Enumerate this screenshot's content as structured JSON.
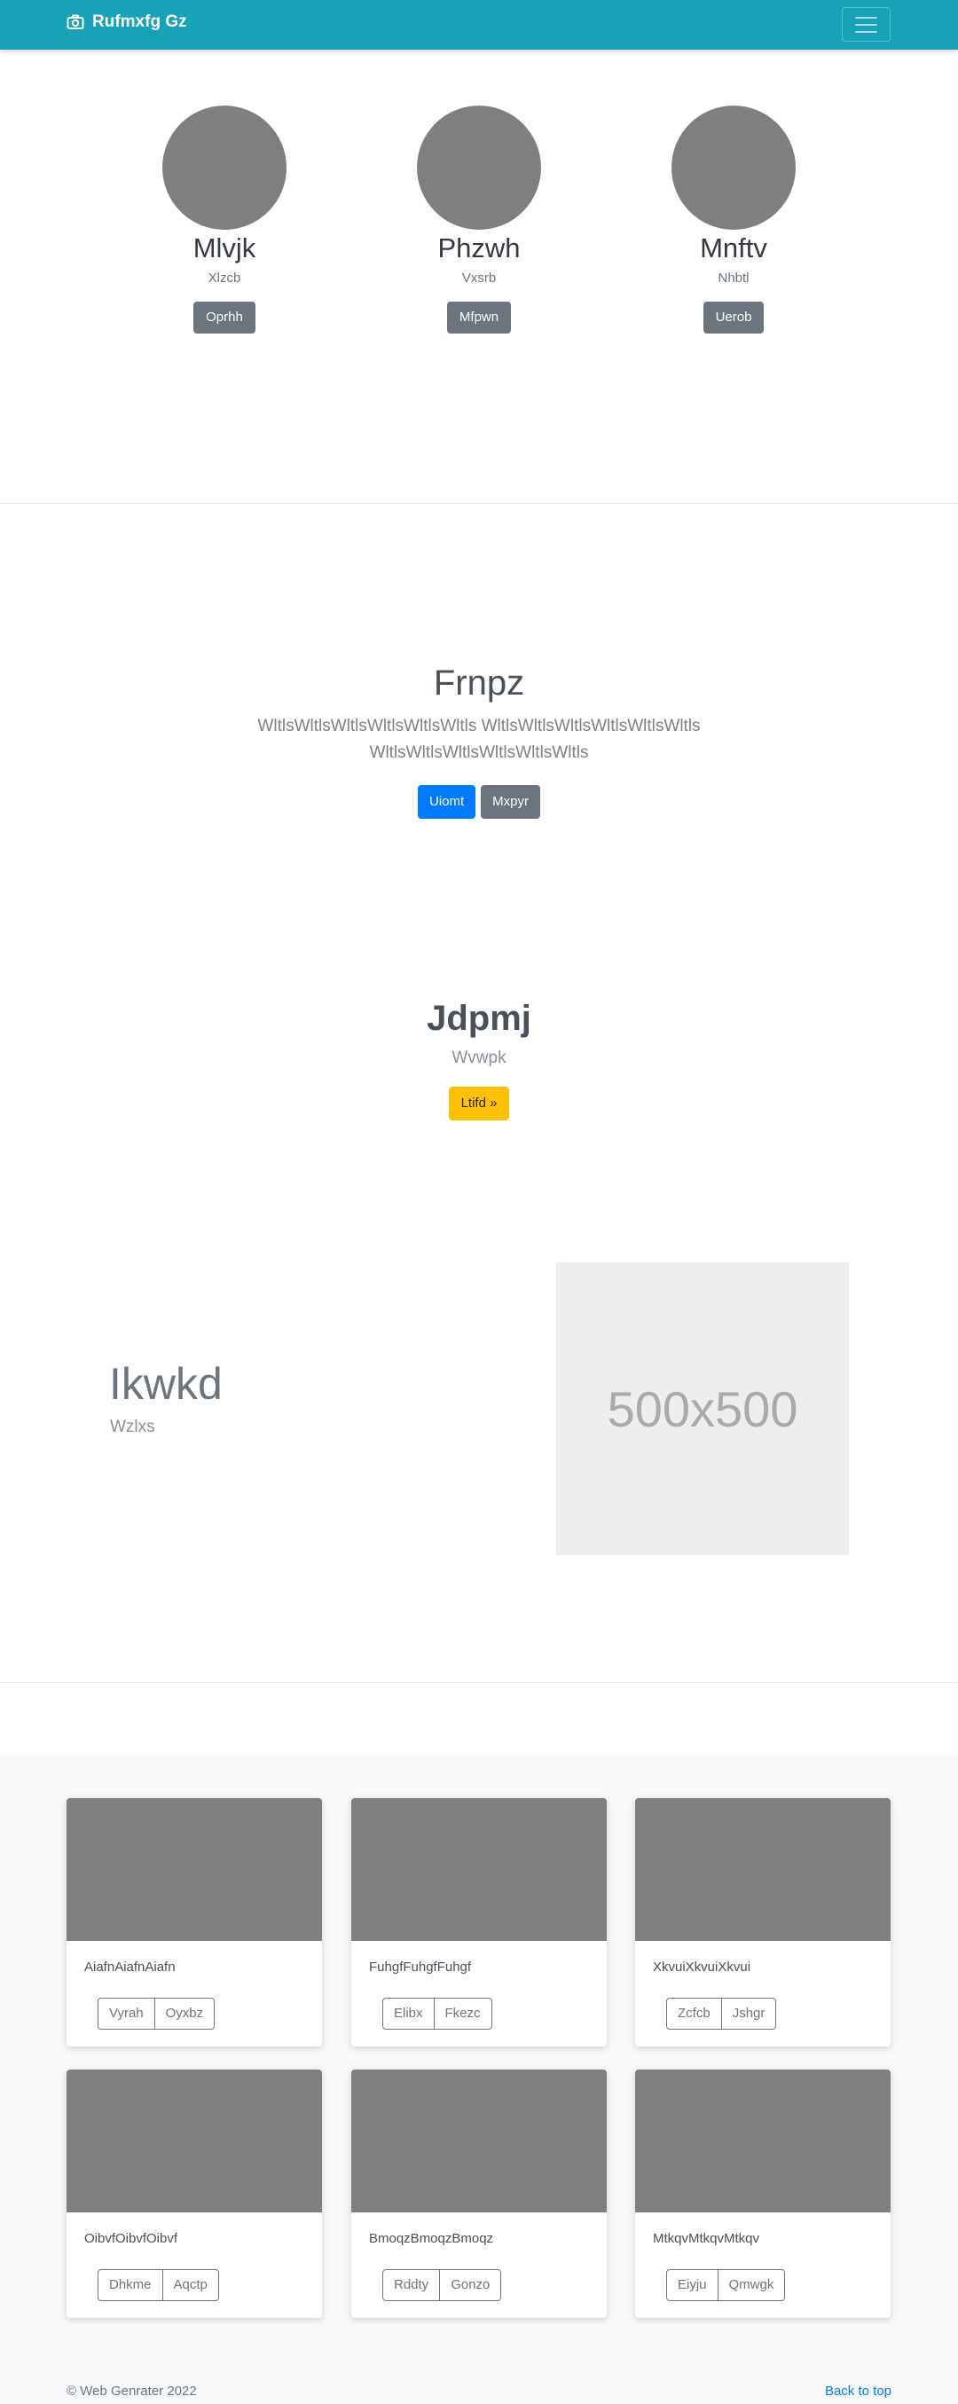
{
  "navbar": {
    "brand": "Rufmxfg Gz",
    "brand_icon": "camera-icon",
    "toggler_icon": "hamburger-icon"
  },
  "team": [
    {
      "name": "Mlvjk",
      "subtitle": "Xlzcb",
      "button": "Oprhh"
    },
    {
      "name": "Phzwh",
      "subtitle": "Vxsrb",
      "button": "Mfpwn"
    },
    {
      "name": "Mnftv",
      "subtitle": "Nhbtl",
      "button": "Uerob"
    }
  ],
  "hero": {
    "title": "Frnpz",
    "text": "WltlsWltlsWltlsWltlsWltlsWltls WltlsWltlsWltlsWltlsWltlsWltls WltlsWltlsWltlsWltlsWltlsWltls",
    "primary_button": "Uiomt",
    "secondary_button": "Mxpyr"
  },
  "promo": {
    "title": "Jdpmj",
    "subtitle": "Wvwpk",
    "button": "Ltifd »"
  },
  "feature": {
    "title": "Ikwkd",
    "subtitle": "Wzlxs",
    "image_label": "500x500"
  },
  "cards": [
    {
      "text": "AiafnAiafnAiafn",
      "buttons": [
        "Vyrah",
        "Oyxbz"
      ]
    },
    {
      "text": "FuhgfFuhgfFuhgf",
      "buttons": [
        "Elibx",
        "Fkezc"
      ]
    },
    {
      "text": "XkvuiXkvuiXkvui",
      "buttons": [
        "Zcfcb",
        "Jshgr"
      ]
    },
    {
      "text": "OibvfOibvfOibvf",
      "buttons": [
        "Dhkme",
        "Aqctp"
      ]
    },
    {
      "text": "BmoqzBmoqzBmoqz",
      "buttons": [
        "Rddty",
        "Gonzo"
      ]
    },
    {
      "text": "MtkqvMtkqvMtkqv",
      "buttons": [
        "Eiyju",
        "Qmwgk"
      ]
    }
  ],
  "footer": {
    "copyright": "© Web Genrater 2022",
    "back_to_top": "Back to top"
  },
  "colors": {
    "navbar": "#17a2b8",
    "primary": "#007bff",
    "secondary": "#6c757d",
    "warning": "#ffc107"
  }
}
